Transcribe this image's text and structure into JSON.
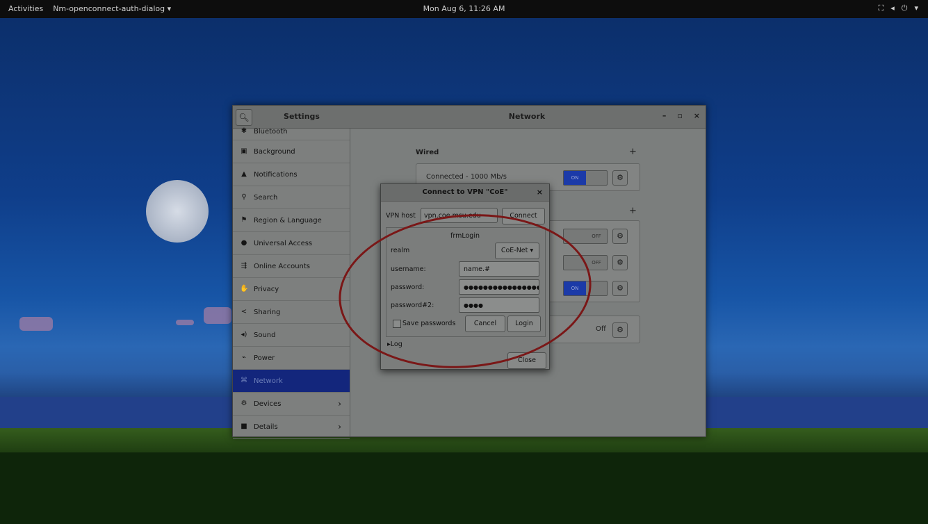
{
  "topbar": {
    "activities": "Activities",
    "app_menu": "Nm-openconnect-auth-dialog ▾",
    "clock": "Mon Aug 6, 11:26 AM",
    "tray": [
      "network-icon",
      "volume-icon",
      "power-icon",
      "chevron-down-icon"
    ]
  },
  "settings": {
    "title": "Settings",
    "panel_title": "Network",
    "controls": {
      "minimize": "–",
      "maximize": "▫",
      "close": "×"
    },
    "sidebar": [
      {
        "label": "Bluetooth",
        "icon": "bluetooth-icon"
      },
      {
        "label": "Background",
        "icon": "background-icon"
      },
      {
        "label": "Notifications",
        "icon": "notifications-icon"
      },
      {
        "label": "Search",
        "icon": "search-icon"
      },
      {
        "label": "Region & Language",
        "icon": "region-icon"
      },
      {
        "label": "Universal Access",
        "icon": "universal-access-icon"
      },
      {
        "label": "Online Accounts",
        "icon": "online-accounts-icon"
      },
      {
        "label": "Privacy",
        "icon": "privacy-icon"
      },
      {
        "label": "Sharing",
        "icon": "sharing-icon"
      },
      {
        "label": "Sound",
        "icon": "sound-icon"
      },
      {
        "label": "Power",
        "icon": "power-icon"
      },
      {
        "label": "Network",
        "icon": "network-icon"
      },
      {
        "label": "Devices",
        "icon": "devices-icon"
      },
      {
        "label": "Details",
        "icon": "details-icon"
      }
    ],
    "wired": {
      "label": "Wired",
      "status": "Connected - 1000 Mb/s",
      "toggle": "ON"
    },
    "vpn_rows": [
      "OFF",
      "OFF",
      "ON"
    ],
    "proxy_state": "Off"
  },
  "vpn_dialog": {
    "title": "Connect to VPN \"CoE\"",
    "host_label": "VPN host",
    "host_value": "vpn.coe.msu.edu",
    "connect": "Connect",
    "form_title": "frmLogin",
    "realm_label": "realm",
    "realm_value": "CoE-Net ▾",
    "username_label": "username:",
    "username_value": "name.#",
    "password_label": "password:",
    "password_value": "●●●●●●●●●●●●●●●●",
    "password2_label": "password#2:",
    "password2_value": "●●●●",
    "save_passwords": "Save passwords",
    "cancel": "Cancel",
    "login": "Login",
    "log": "Log",
    "close": "Close"
  }
}
